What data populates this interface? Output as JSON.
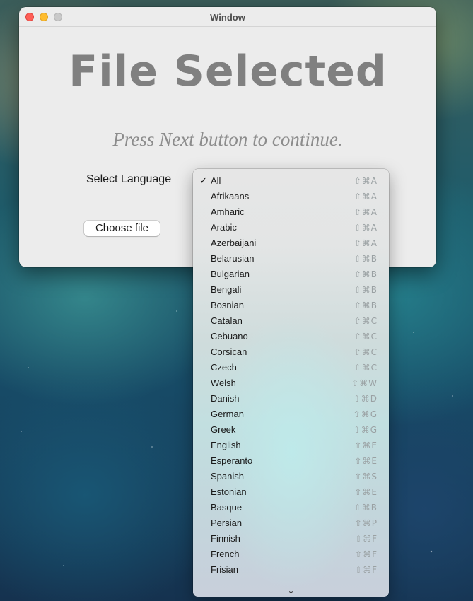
{
  "window": {
    "title": "Window",
    "headline": "File Selected",
    "subline": "Press Next button to continue.",
    "language_label": "Select Language",
    "choose_file_label": "Choose file"
  },
  "language_menu": {
    "selected": "All",
    "check_mark": "✓",
    "more_arrow": "⌄",
    "items": [
      {
        "label": "All",
        "shortcut": "⇧⌘A"
      },
      {
        "label": "Afrikaans",
        "shortcut": "⇧⌘A"
      },
      {
        "label": "Amharic",
        "shortcut": "⇧⌘A"
      },
      {
        "label": "Arabic",
        "shortcut": "⇧⌘A"
      },
      {
        "label": "Azerbaijani",
        "shortcut": "⇧⌘A"
      },
      {
        "label": "Belarusian",
        "shortcut": "⇧⌘B"
      },
      {
        "label": "Bulgarian",
        "shortcut": "⇧⌘B"
      },
      {
        "label": "Bengali",
        "shortcut": "⇧⌘B"
      },
      {
        "label": "Bosnian",
        "shortcut": "⇧⌘B"
      },
      {
        "label": "Catalan",
        "shortcut": "⇧⌘C"
      },
      {
        "label": "Cebuano",
        "shortcut": "⇧⌘C"
      },
      {
        "label": "Corsican",
        "shortcut": "⇧⌘C"
      },
      {
        "label": "Czech",
        "shortcut": "⇧⌘C"
      },
      {
        "label": "Welsh",
        "shortcut": "⇧⌘W"
      },
      {
        "label": "Danish",
        "shortcut": "⇧⌘D"
      },
      {
        "label": "German",
        "shortcut": "⇧⌘G"
      },
      {
        "label": "Greek",
        "shortcut": "⇧⌘G"
      },
      {
        "label": "English",
        "shortcut": "⇧⌘E"
      },
      {
        "label": "Esperanto",
        "shortcut": "⇧⌘E"
      },
      {
        "label": "Spanish",
        "shortcut": "⇧⌘S"
      },
      {
        "label": "Estonian",
        "shortcut": "⇧⌘E"
      },
      {
        "label": "Basque",
        "shortcut": "⇧⌘B"
      },
      {
        "label": "Persian",
        "shortcut": "⇧⌘P"
      },
      {
        "label": "Finnish",
        "shortcut": "⇧⌘F"
      },
      {
        "label": "French",
        "shortcut": "⇧⌘F"
      },
      {
        "label": "Frisian",
        "shortcut": "⇧⌘F"
      }
    ]
  }
}
